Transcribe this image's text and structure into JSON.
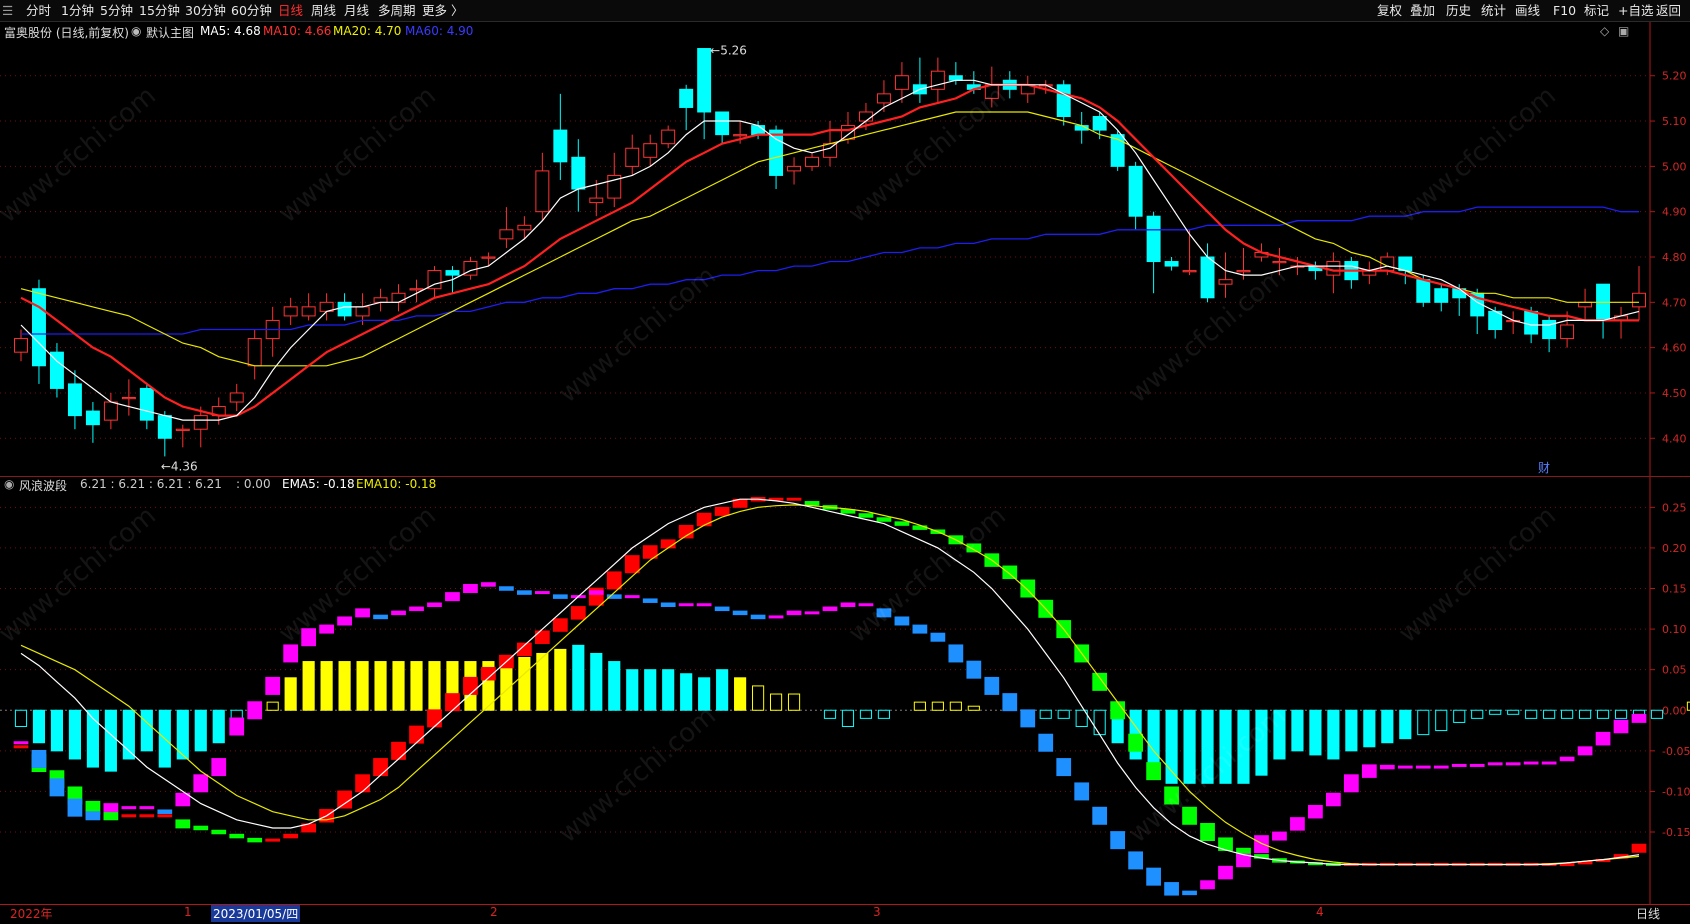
{
  "toolbar": {
    "left_items": [
      "分时",
      "1分钟",
      "5分钟",
      "15分钟",
      "30分钟",
      "60分钟",
      "日线",
      "周线",
      "月线",
      "多周期",
      "更多 〉"
    ],
    "active_item": "日线",
    "right_items": [
      "复权",
      "叠加",
      "历史",
      "统计",
      "画线",
      "F10",
      "标记",
      "+自选",
      "返回"
    ]
  },
  "main_header": {
    "stock": "富奥股份 (日线,前复权)",
    "template": "默认主图",
    "ma5": "MA5: 4.68",
    "ma10": "MA10: 4.66",
    "ma20": "MA20: 4.70",
    "ma60": "MA60: 4.90"
  },
  "sub_header": {
    "indicator": "风浪波段",
    "v1": "6.21 : 6.21 : 6.21 : 6.21",
    "v2": ": 0.00",
    "ema5": "EMA5: -0.18",
    "ema10": "EMA10: -0.18"
  },
  "price_axis": [
    "5.20",
    "5.10",
    "5.00",
    "4.90",
    "4.80",
    "4.70",
    "4.60",
    "4.50",
    "4.40"
  ],
  "sub_axis": [
    "0.25",
    "0.20",
    "0.15",
    "0.10",
    "0.05",
    "0.00",
    "-0.05",
    "-0.10",
    "-0.15"
  ],
  "annotations": {
    "high": "5.26",
    "low": "4.36",
    "fin_marker": "财"
  },
  "bottom": {
    "labels": [
      "2022年",
      "1",
      "2023/01/05/四",
      "2",
      "3",
      "4"
    ],
    "period": "日线"
  },
  "watermark": "www.cfchi.com",
  "colors": {
    "up": "#ff3232",
    "down": "#00ffff",
    "ma5": "#ffffff",
    "ma10": "#ff2020",
    "ma20": "#e8e800",
    "ma60": "#1e1ef0",
    "grid": "#701010",
    "magenta": "#ff00ff",
    "green": "#00ff00",
    "blue": "#1e90ff",
    "yellow": "#ffff00"
  },
  "chart_data": {
    "type": "candlestick",
    "ylim": [
      4.33,
      5.27
    ],
    "candles": [
      [
        4.59,
        4.62,
        4.57,
        4.64
      ],
      [
        4.73,
        4.56,
        4.52,
        4.75
      ],
      [
        4.59,
        4.51,
        4.49,
        4.61
      ],
      [
        4.52,
        4.45,
        4.42,
        4.55
      ],
      [
        4.46,
        4.43,
        4.39,
        4.48
      ],
      [
        4.44,
        4.48,
        4.42,
        4.5
      ],
      [
        4.49,
        4.49,
        4.45,
        4.53
      ],
      [
        4.51,
        4.44,
        4.42,
        4.52
      ],
      [
        4.45,
        4.4,
        4.36,
        4.46
      ],
      [
        4.42,
        4.42,
        4.38,
        4.43
      ],
      [
        4.42,
        4.45,
        4.38,
        4.47
      ],
      [
        4.45,
        4.47,
        4.43,
        4.49
      ],
      [
        4.48,
        4.5,
        4.46,
        4.52
      ],
      [
        4.56,
        4.62,
        4.53,
        4.64
      ],
      [
        4.62,
        4.66,
        4.58,
        4.69
      ],
      [
        4.67,
        4.69,
        4.65,
        4.71
      ],
      [
        4.67,
        4.69,
        4.66,
        4.72
      ],
      [
        4.68,
        4.7,
        4.66,
        4.72
      ],
      [
        4.7,
        4.67,
        4.66,
        4.72
      ],
      [
        4.67,
        4.69,
        4.65,
        4.72
      ],
      [
        4.7,
        4.71,
        4.68,
        4.73
      ],
      [
        4.7,
        4.72,
        4.68,
        4.74
      ],
      [
        4.73,
        4.73,
        4.7,
        4.75
      ],
      [
        4.73,
        4.77,
        4.71,
        4.78
      ],
      [
        4.77,
        4.76,
        4.72,
        4.78
      ],
      [
        4.76,
        4.79,
        4.75,
        4.8
      ],
      [
        4.8,
        4.8,
        4.78,
        4.81
      ],
      [
        4.84,
        4.86,
        4.82,
        4.91
      ],
      [
        4.86,
        4.87,
        4.84,
        4.89
      ],
      [
        4.9,
        4.99,
        4.88,
        5.03
      ],
      [
        5.08,
        5.01,
        4.97,
        5.16
      ],
      [
        5.02,
        4.95,
        4.9,
        5.06
      ],
      [
        4.92,
        4.93,
        4.89,
        4.97
      ],
      [
        4.93,
        4.98,
        4.91,
        5.03
      ],
      [
        5.0,
        5.04,
        4.98,
        5.07
      ],
      [
        5.02,
        5.05,
        5.0,
        5.07
      ],
      [
        5.05,
        5.08,
        5.04,
        5.09
      ],
      [
        5.17,
        5.13,
        5.08,
        5.18
      ],
      [
        5.26,
        5.12,
        5.06,
        5.26
      ],
      [
        5.12,
        5.07,
        5.05,
        5.12
      ],
      [
        5.07,
        5.07,
        5.05,
        5.1
      ],
      [
        5.09,
        5.07,
        5.06,
        5.1
      ],
      [
        5.08,
        4.98,
        4.95,
        5.09
      ],
      [
        4.99,
        5.0,
        4.96,
        5.02
      ],
      [
        5.0,
        5.02,
        4.99,
        5.03
      ],
      [
        5.02,
        5.05,
        5.0,
        5.1
      ],
      [
        5.06,
        5.09,
        5.05,
        5.12
      ],
      [
        5.1,
        5.12,
        5.08,
        5.14
      ],
      [
        5.14,
        5.16,
        5.12,
        5.19
      ],
      [
        5.17,
        5.2,
        5.14,
        5.23
      ],
      [
        5.18,
        5.16,
        5.14,
        5.24
      ],
      [
        5.17,
        5.21,
        5.14,
        5.24
      ],
      [
        5.2,
        5.19,
        5.18,
        5.23
      ],
      [
        5.18,
        5.17,
        5.16,
        5.21
      ],
      [
        5.15,
        5.18,
        5.13,
        5.22
      ],
      [
        5.19,
        5.17,
        5.15,
        5.21
      ],
      [
        5.16,
        5.18,
        5.14,
        5.2
      ],
      [
        5.18,
        5.18,
        5.16,
        5.19
      ],
      [
        5.18,
        5.11,
        5.09,
        5.19
      ],
      [
        5.09,
        5.08,
        5.05,
        5.12
      ],
      [
        5.11,
        5.08,
        5.06,
        5.12
      ],
      [
        5.07,
        5.0,
        4.99,
        5.08
      ],
      [
        5.0,
        4.89,
        4.86,
        5.01
      ],
      [
        4.89,
        4.79,
        4.72,
        4.9
      ],
      [
        4.79,
        4.78,
        4.77,
        4.8
      ],
      [
        4.77,
        4.77,
        4.76,
        4.86
      ],
      [
        4.8,
        4.71,
        4.7,
        4.83
      ],
      [
        4.74,
        4.75,
        4.71,
        4.81
      ],
      [
        4.77,
        4.77,
        4.75,
        4.82
      ],
      [
        4.8,
        4.81,
        4.79,
        4.83
      ],
      [
        4.79,
        4.79,
        4.76,
        4.82
      ],
      [
        4.78,
        4.78,
        4.76,
        4.8
      ],
      [
        4.78,
        4.77,
        4.75,
        4.79
      ],
      [
        4.76,
        4.79,
        4.72,
        4.81
      ],
      [
        4.79,
        4.75,
        4.73,
        4.8
      ],
      [
        4.76,
        4.77,
        4.74,
        4.79
      ],
      [
        4.77,
        4.8,
        4.76,
        4.81
      ],
      [
        4.8,
        4.77,
        4.74,
        4.8
      ],
      [
        4.75,
        4.7,
        4.69,
        4.76
      ],
      [
        4.73,
        4.7,
        4.68,
        4.74
      ],
      [
        4.73,
        4.71,
        4.67,
        4.74
      ],
      [
        4.72,
        4.67,
        4.63,
        4.73
      ],
      [
        4.68,
        4.64,
        4.62,
        4.69
      ],
      [
        4.66,
        4.66,
        4.63,
        4.68
      ],
      [
        4.68,
        4.63,
        4.61,
        4.69
      ],
      [
        4.66,
        4.62,
        4.59,
        4.67
      ],
      [
        4.62,
        4.65,
        4.6,
        4.68
      ],
      [
        4.69,
        4.7,
        4.66,
        4.73
      ],
      [
        4.74,
        4.66,
        4.62,
        4.74
      ],
      [
        4.66,
        4.67,
        4.62,
        4.69
      ],
      [
        4.69,
        4.72,
        4.66,
        4.78
      ]
    ],
    "ma5": [
      4.65,
      4.61,
      4.57,
      4.54,
      4.51,
      4.48,
      4.47,
      4.46,
      4.45,
      4.44,
      4.44,
      4.44,
      4.45,
      4.49,
      4.55,
      4.6,
      4.64,
      4.68,
      4.69,
      4.69,
      4.7,
      4.7,
      4.72,
      4.74,
      4.75,
      4.77,
      4.78,
      4.81,
      4.84,
      4.88,
      4.93,
      4.95,
      4.96,
      4.97,
      4.98,
      5.0,
      5.03,
      5.07,
      5.1,
      5.1,
      5.1,
      5.09,
      5.06,
      5.04,
      5.03,
      5.04,
      5.07,
      5.1,
      5.13,
      5.15,
      5.17,
      5.18,
      5.19,
      5.19,
      5.18,
      5.18,
      5.18,
      5.18,
      5.16,
      5.14,
      5.12,
      5.08,
      5.03,
      4.97,
      4.91,
      4.85,
      4.8,
      4.77,
      4.76,
      4.76,
      4.77,
      4.78,
      4.78,
      4.78,
      4.78,
      4.77,
      4.78,
      4.77,
      4.76,
      4.75,
      4.73,
      4.7,
      4.68,
      4.66,
      4.65,
      4.65,
      4.66,
      4.66,
      4.66,
      4.67,
      4.68
    ],
    "ma10": [
      4.71,
      4.69,
      4.66,
      4.63,
      4.6,
      4.58,
      4.55,
      4.52,
      4.49,
      4.47,
      4.46,
      4.45,
      4.45,
      4.47,
      4.5,
      4.53,
      4.56,
      4.59,
      4.61,
      4.63,
      4.65,
      4.67,
      4.69,
      4.71,
      4.72,
      4.73,
      4.74,
      4.76,
      4.78,
      4.81,
      4.84,
      4.86,
      4.88,
      4.9,
      4.92,
      4.95,
      4.98,
      5.01,
      5.03,
      5.05,
      5.06,
      5.07,
      5.07,
      5.07,
      5.07,
      5.08,
      5.08,
      5.09,
      5.1,
      5.11,
      5.13,
      5.14,
      5.15,
      5.17,
      5.18,
      5.18,
      5.18,
      5.17,
      5.16,
      5.15,
      5.13,
      5.1,
      5.06,
      5.02,
      4.98,
      4.94,
      4.9,
      4.86,
      4.83,
      4.81,
      4.8,
      4.79,
      4.78,
      4.77,
      4.77,
      4.77,
      4.77,
      4.76,
      4.75,
      4.74,
      4.73,
      4.71,
      4.7,
      4.69,
      4.68,
      4.67,
      4.67,
      4.66,
      4.66,
      4.66,
      4.66
    ],
    "ma20": [
      4.73,
      4.72,
      4.71,
      4.7,
      4.69,
      4.68,
      4.67,
      4.65,
      4.63,
      4.61,
      4.6,
      4.58,
      4.57,
      4.56,
      4.56,
      4.56,
      4.56,
      4.56,
      4.57,
      4.58,
      4.6,
      4.62,
      4.64,
      4.66,
      4.68,
      4.7,
      4.72,
      4.74,
      4.76,
      4.78,
      4.8,
      4.82,
      4.84,
      4.86,
      4.88,
      4.89,
      4.91,
      4.93,
      4.95,
      4.97,
      4.99,
      5.01,
      5.02,
      5.03,
      5.04,
      5.05,
      5.06,
      5.07,
      5.08,
      5.09,
      5.1,
      5.11,
      5.12,
      5.12,
      5.12,
      5.12,
      5.12,
      5.11,
      5.1,
      5.09,
      5.07,
      5.06,
      5.04,
      5.02,
      5.0,
      4.98,
      4.96,
      4.94,
      4.92,
      4.9,
      4.88,
      4.86,
      4.84,
      4.83,
      4.81,
      4.8,
      4.78,
      4.77,
      4.75,
      4.74,
      4.73,
      4.72,
      4.72,
      4.71,
      4.71,
      4.71,
      4.7,
      4.7,
      4.7,
      4.7,
      4.7
    ],
    "ma60": [
      4.63,
      4.63,
      4.63,
      4.63,
      4.63,
      4.63,
      4.63,
      4.63,
      4.63,
      4.63,
      4.64,
      4.64,
      4.64,
      4.64,
      4.64,
      4.64,
      4.65,
      4.65,
      4.65,
      4.66,
      4.66,
      4.66,
      4.67,
      4.67,
      4.68,
      4.68,
      4.69,
      4.7,
      4.7,
      4.71,
      4.71,
      4.72,
      4.72,
      4.73,
      4.73,
      4.74,
      4.74,
      4.75,
      4.75,
      4.76,
      4.76,
      4.77,
      4.77,
      4.78,
      4.78,
      4.79,
      4.79,
      4.8,
      4.81,
      4.81,
      4.82,
      4.82,
      4.83,
      4.83,
      4.84,
      4.84,
      4.84,
      4.85,
      4.85,
      4.85,
      4.85,
      4.86,
      4.86,
      4.86,
      4.86,
      4.86,
      4.87,
      4.87,
      4.87,
      4.87,
      4.87,
      4.88,
      4.88,
      4.88,
      4.88,
      4.89,
      4.89,
      4.89,
      4.9,
      4.9,
      4.9,
      4.91,
      4.91,
      4.91,
      4.91,
      4.91,
      4.91,
      4.91,
      4.91,
      4.9,
      4.9
    ],
    "sub_ylim": [
      -0.235,
      0.28
    ],
    "wave_left": [
      -0.045,
      -0.065,
      -0.085,
      -0.105,
      -0.12,
      -0.13,
      -0.13,
      -0.13,
      -0.13,
      -0.14,
      -0.145,
      -0.15,
      -0.155,
      -0.16,
      -0.16,
      -0.155,
      -0.145,
      -0.13,
      -0.11,
      -0.09,
      -0.07,
      -0.05,
      -0.03,
      -0.01,
      0.01,
      0.03,
      0.045,
      0.06,
      0.075,
      0.09,
      0.105,
      0.12,
      0.14,
      0.16,
      0.18,
      0.195,
      0.205,
      0.22,
      0.235,
      0.245,
      0.255,
      0.26,
      0.26,
      0.26,
      0.255,
      0.25,
      0.245,
      0.24,
      0.235,
      0.23,
      0.225,
      0.22,
      0.21,
      0.2,
      0.185,
      0.17,
      0.15,
      0.125,
      0.1,
      0.07,
      0.035,
      0.0,
      -0.04,
      -0.075,
      -0.105,
      -0.13,
      -0.15,
      -0.165,
      -0.175,
      -0.18,
      -0.185,
      -0.187,
      -0.189,
      -0.19,
      -0.19,
      -0.19,
      -0.19,
      -0.19,
      -0.19,
      -0.19,
      -0.19,
      -0.19,
      -0.19,
      -0.19,
      -0.19,
      -0.19,
      -0.19,
      -0.188,
      -0.185,
      -0.18,
      -0.17
    ],
    "wave_right": [
      -0.04,
      -0.06,
      -0.095,
      -0.12,
      -0.13,
      -0.12,
      -0.12,
      -0.12,
      -0.125,
      -0.11,
      -0.09,
      -0.07,
      -0.02,
      0.0,
      0.03,
      0.07,
      0.09,
      0.1,
      0.11,
      0.12,
      0.115,
      0.12,
      0.125,
      0.13,
      0.14,
      0.15,
      0.155,
      0.15,
      0.145,
      0.145,
      0.14,
      0.14,
      0.145,
      0.14,
      0.14,
      0.135,
      0.13,
      0.13,
      0.13,
      0.125,
      0.12,
      0.115,
      0.115,
      0.12,
      0.12,
      0.125,
      0.13,
      0.13,
      0.12,
      0.11,
      0.1,
      0.09,
      0.07,
      0.05,
      0.03,
      0.01,
      -0.01,
      -0.04,
      -0.07,
      -0.1,
      -0.13,
      -0.16,
      -0.185,
      -0.205,
      -0.22,
      -0.225,
      -0.215,
      -0.2,
      -0.185,
      -0.165,
      -0.155,
      -0.14,
      -0.125,
      -0.11,
      -0.09,
      -0.075,
      -0.07,
      -0.07,
      -0.07,
      -0.07,
      -0.068,
      -0.068,
      -0.066,
      -0.066,
      -0.065,
      -0.065,
      -0.06,
      -0.05,
      -0.035,
      -0.02,
      -0.01
    ],
    "ema5": [
      0.07,
      0.055,
      0.035,
      0.015,
      -0.01,
      -0.03,
      -0.05,
      -0.07,
      -0.085,
      -0.1,
      -0.115,
      -0.125,
      -0.135,
      -0.14,
      -0.145,
      -0.145,
      -0.14,
      -0.13,
      -0.115,
      -0.1,
      -0.08,
      -0.06,
      -0.04,
      -0.02,
      0.0,
      0.02,
      0.04,
      0.06,
      0.08,
      0.1,
      0.12,
      0.14,
      0.16,
      0.18,
      0.2,
      0.215,
      0.23,
      0.24,
      0.25,
      0.255,
      0.26,
      0.26,
      0.258,
      0.255,
      0.25,
      0.245,
      0.24,
      0.235,
      0.23,
      0.22,
      0.21,
      0.2,
      0.185,
      0.17,
      0.15,
      0.125,
      0.1,
      0.07,
      0.04,
      0.005,
      -0.03,
      -0.065,
      -0.095,
      -0.12,
      -0.14,
      -0.155,
      -0.165,
      -0.172,
      -0.178,
      -0.182,
      -0.185,
      -0.187,
      -0.188,
      -0.19,
      -0.19,
      -0.19,
      -0.19,
      -0.19,
      -0.19,
      -0.19,
      -0.19,
      -0.19,
      -0.19,
      -0.19,
      -0.19,
      -0.19,
      -0.188,
      -0.186,
      -0.184,
      -0.181,
      -0.178
    ],
    "ema10": [
      0.08,
      0.07,
      0.06,
      0.05,
      0.035,
      0.02,
      0.005,
      -0.015,
      -0.035,
      -0.055,
      -0.075,
      -0.09,
      -0.105,
      -0.115,
      -0.125,
      -0.13,
      -0.135,
      -0.135,
      -0.13,
      -0.12,
      -0.11,
      -0.095,
      -0.075,
      -0.055,
      -0.035,
      -0.015,
      0.005,
      0.025,
      0.045,
      0.065,
      0.085,
      0.105,
      0.125,
      0.145,
      0.165,
      0.185,
      0.2,
      0.215,
      0.228,
      0.238,
      0.245,
      0.25,
      0.252,
      0.253,
      0.252,
      0.25,
      0.248,
      0.245,
      0.24,
      0.235,
      0.228,
      0.22,
      0.21,
      0.198,
      0.185,
      0.168,
      0.148,
      0.125,
      0.1,
      0.07,
      0.04,
      0.01,
      -0.02,
      -0.05,
      -0.075,
      -0.1,
      -0.12,
      -0.138,
      -0.152,
      -0.164,
      -0.173,
      -0.179,
      -0.184,
      -0.187,
      -0.189,
      -0.19,
      -0.19,
      -0.19,
      -0.19,
      -0.19,
      -0.19,
      -0.19,
      -0.19,
      -0.19,
      -0.19,
      -0.189,
      -0.188,
      -0.186,
      -0.184,
      -0.182,
      -0.18
    ],
    "hist": [
      -0.02,
      -0.04,
      -0.05,
      -0.06,
      -0.07,
      -0.075,
      -0.06,
      -0.05,
      -0.07,
      -0.06,
      -0.05,
      -0.04,
      -0.02,
      -0.01,
      0.01,
      0.04,
      0.06,
      0.06,
      0.06,
      0.06,
      0.06,
      0.06,
      0.06,
      0.06,
      0.06,
      0.06,
      0.06,
      0.06,
      0.065,
      0.07,
      0.075,
      0.08,
      0.07,
      0.06,
      0.05,
      0.05,
      0.05,
      0.045,
      0.04,
      0.05,
      0.04,
      0.03,
      0.02,
      0.02,
      0.0,
      -0.01,
      -0.02,
      -0.01,
      -0.01,
      0.0,
      0.01,
      0.01,
      0.01,
      0.005,
      0.0,
      0.0,
      -0.005,
      -0.01,
      -0.01,
      -0.02,
      -0.03,
      -0.04,
      -0.06,
      -0.08,
      -0.09,
      -0.09,
      -0.09,
      -0.09,
      -0.09,
      -0.08,
      -0.06,
      -0.05,
      -0.055,
      -0.06,
      -0.05,
      -0.045,
      -0.04,
      -0.035,
      -0.03,
      -0.025,
      -0.015,
      -0.01,
      -0.005,
      -0.005,
      -0.01,
      -0.01,
      -0.01,
      -0.01,
      -0.01,
      -0.01,
      -0.01,
      -0.01,
      0.0,
      0.01,
      0.015,
      0.02
    ]
  }
}
